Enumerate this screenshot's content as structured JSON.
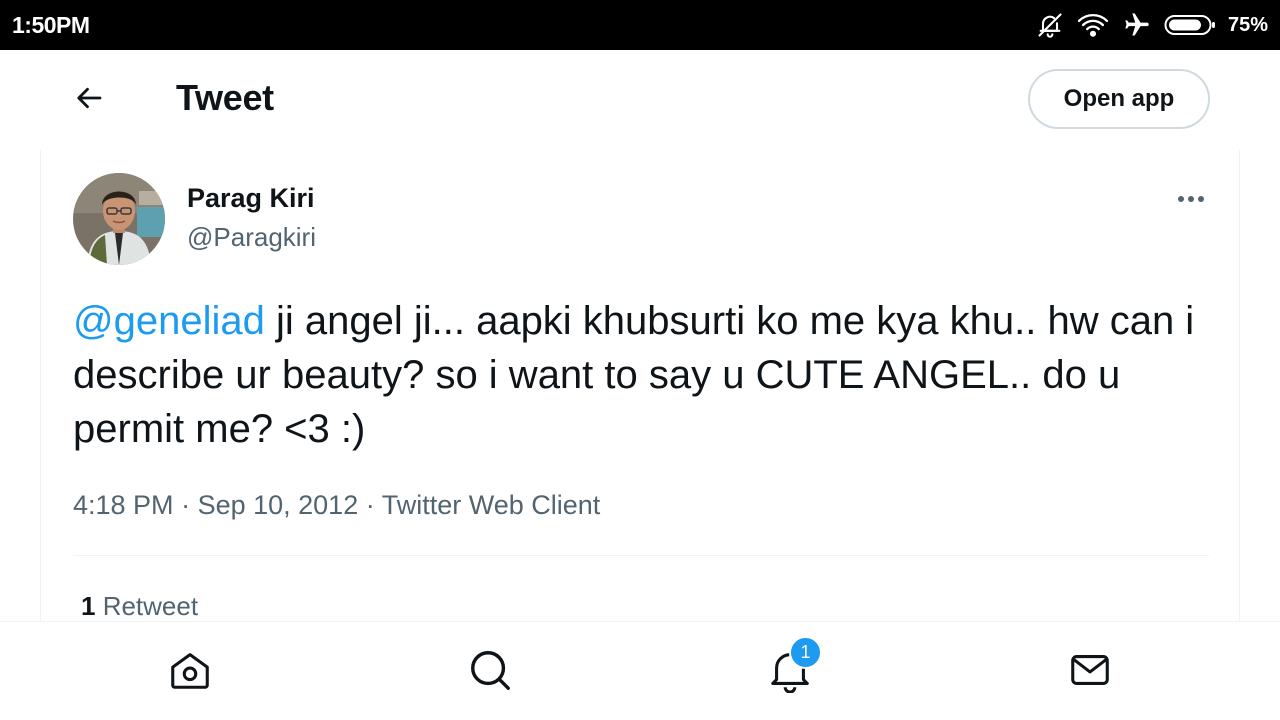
{
  "status_bar": {
    "time": "1:50PM",
    "battery_percent": "75%",
    "icons": [
      "bell-muted-icon",
      "wifi-icon",
      "airplane-mode-icon",
      "battery-icon"
    ]
  },
  "header": {
    "title": "Tweet",
    "back_icon": "arrow-left-icon",
    "open_app_label": "Open app"
  },
  "tweet": {
    "author": {
      "display_name": "Parag Kiri",
      "handle": "@Paragkiri"
    },
    "more_icon": "more-horizontal-icon",
    "mention": "@geneliad",
    "text": " ji angel ji... aapki khubsurti ko me kya khu.. hw can i describe ur beauty? so i want to say u  CUTE ANGEL.. do u permit me? <3 :)",
    "time": "4:18 PM",
    "separator": " · ",
    "date": "Sep 10, 2012",
    "source": "Twitter Web Client",
    "stats": {
      "retweet_count": "1",
      "retweet_label": " Retweet"
    }
  },
  "bottom_nav": {
    "items": [
      "home-icon",
      "search-icon",
      "notifications-icon",
      "messages-icon"
    ],
    "notification_badge": "1"
  },
  "colors": {
    "accent": "#1d9bf0",
    "text_primary": "#0f1419",
    "text_secondary": "#536471",
    "border": "#eff3f4",
    "status_bar": "#000000"
  }
}
